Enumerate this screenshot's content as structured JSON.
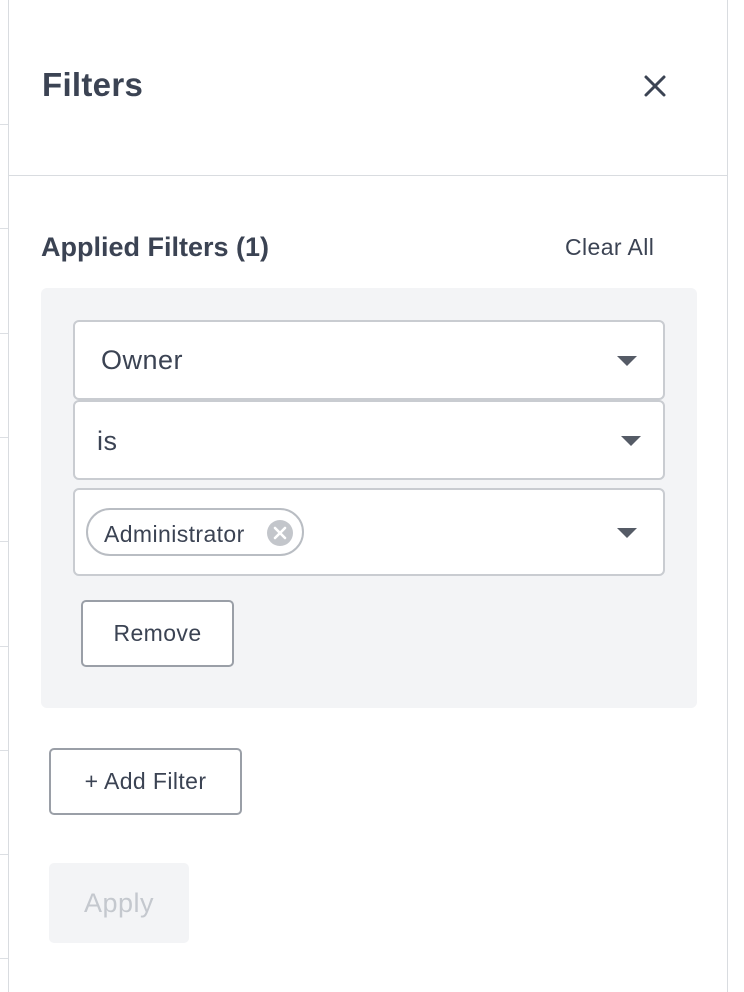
{
  "panel": {
    "title": "Filters",
    "close_icon": "close-icon"
  },
  "applied": {
    "title": "Applied Filters (1)",
    "clear_all_label": "Clear All"
  },
  "filter": {
    "field_value": "Owner",
    "operator_value": "is",
    "values": [
      "Administrator"
    ],
    "remove_label": "Remove"
  },
  "actions": {
    "add_filter_label": "+ Add Filter",
    "apply_label": "Apply",
    "apply_enabled": false
  },
  "colors": {
    "text": "#3b4353",
    "filter_bg": "#f3f4f6",
    "border": "#c9ccd1",
    "disabled_text": "#c4c8ce"
  }
}
